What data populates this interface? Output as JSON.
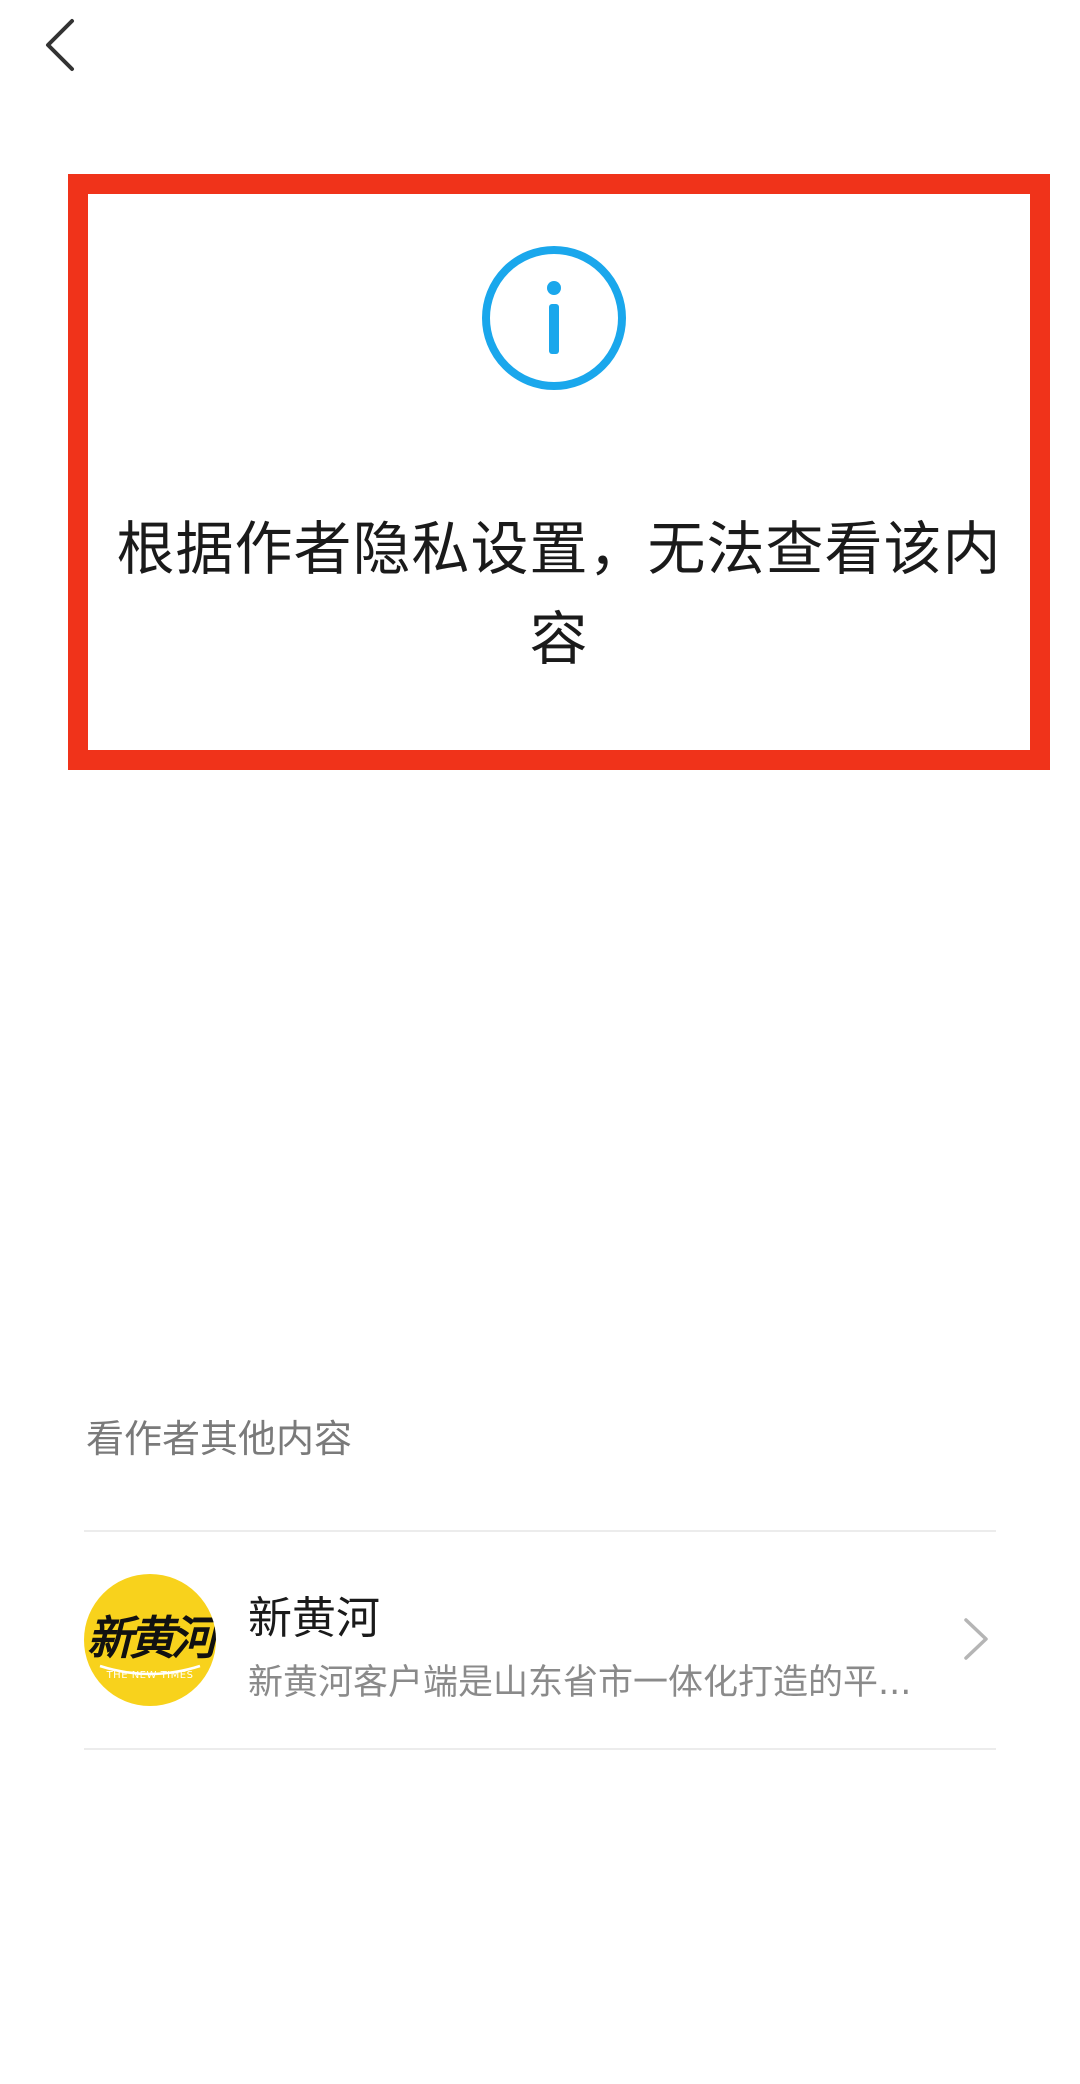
{
  "nav": {
    "back_icon": "chevron-left-icon"
  },
  "notice": {
    "icon": "info-circle-icon",
    "icon_color": "#1aa7ec",
    "border_color": "#f0331a",
    "message": "根据作者隐私设置，无法查看该内容"
  },
  "other_content": {
    "section_title": "看作者其他内容",
    "author": {
      "avatar_text": "新黄河",
      "avatar_subtext": "THE NEW TIMES",
      "name": "新黄河",
      "description": "新黄河客户端是山东省市一体化打造的平..."
    }
  }
}
